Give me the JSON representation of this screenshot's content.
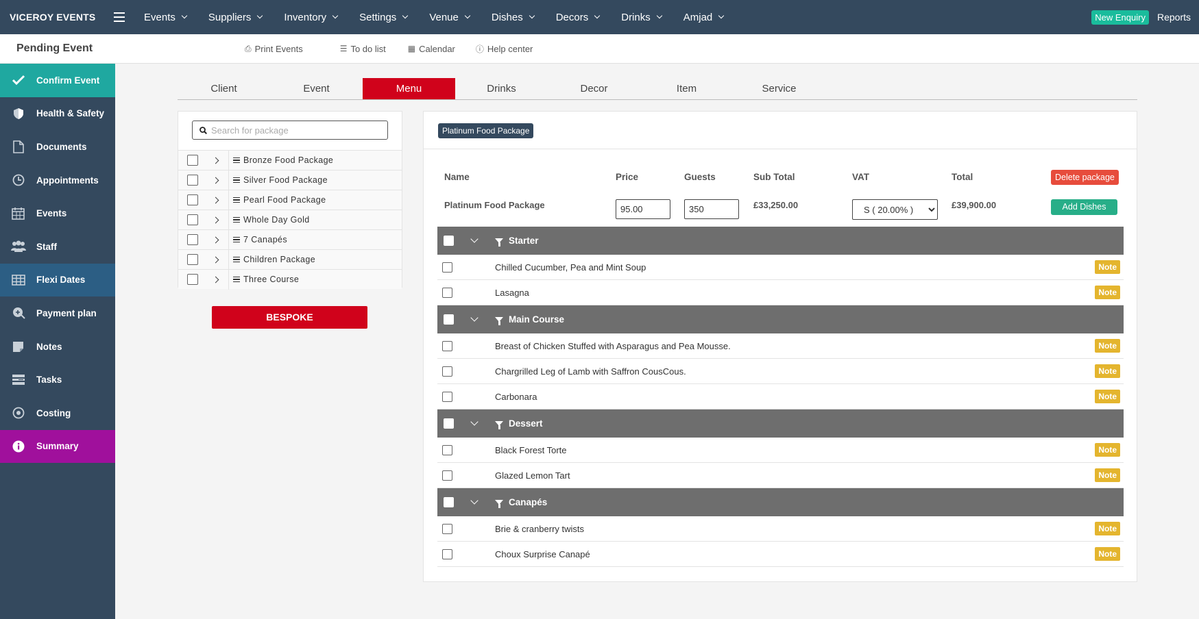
{
  "app": {
    "brand": "VICEROY EVENTS"
  },
  "topnav": {
    "items": [
      "Events",
      "Suppliers",
      "Inventory",
      "Settings",
      "Venue",
      "Dishes",
      "Decors",
      "Drinks",
      "Amjad"
    ],
    "new_enquiry": "New Enquiry",
    "reports": "Reports"
  },
  "subheader": {
    "title": "Pending Event",
    "links": [
      "Print Events",
      "To do list",
      "Calendar",
      "Help center"
    ]
  },
  "sidebar": {
    "items": [
      {
        "label": "Confirm Event",
        "icon": "check-icon",
        "state": "teal"
      },
      {
        "label": "Health & Safety",
        "icon": "shield-icon",
        "state": ""
      },
      {
        "label": "Documents",
        "icon": "document-icon",
        "state": ""
      },
      {
        "label": "Appointments",
        "icon": "clock-icon",
        "state": ""
      },
      {
        "label": "Events",
        "icon": "calendar-icon",
        "state": ""
      },
      {
        "label": "Staff",
        "icon": "users-icon",
        "state": ""
      },
      {
        "label": "Flexi Dates",
        "icon": "table-icon",
        "state": "blue"
      },
      {
        "label": "Payment plan",
        "icon": "payment-icon",
        "state": ""
      },
      {
        "label": "Notes",
        "icon": "sticky-note-icon",
        "state": ""
      },
      {
        "label": "Tasks",
        "icon": "tasks-icon",
        "state": ""
      },
      {
        "label": "Costing",
        "icon": "target-icon",
        "state": ""
      },
      {
        "label": "Summary",
        "icon": "info-icon",
        "state": "purple"
      }
    ]
  },
  "tabs": {
    "items": [
      "Client",
      "Event",
      "Menu",
      "Drinks",
      "Decor",
      "Item",
      "Service"
    ],
    "active": "Menu"
  },
  "packages": {
    "search_placeholder": "Search for package",
    "items": [
      "Bronze Food Package",
      "Silver Food Package",
      "Pearl Food Package",
      "Whole Day Gold",
      "7 Canapés",
      "Children Package",
      "Three Course"
    ],
    "bespoke_label": "BESPOKE"
  },
  "detail": {
    "badge": "Platinum Food Package",
    "headers": {
      "name": "Name",
      "price": "Price",
      "guests": "Guests",
      "subtotal": "Sub Total",
      "vat": "VAT",
      "total": "Total"
    },
    "row": {
      "name": "Platinum Food Package",
      "price": "95.00",
      "guests": "350",
      "subtotal": "£33,250.00",
      "vat": "S ( 20.00% )",
      "total": "£39,900.00"
    },
    "delete_label": "Delete package",
    "add_label": "Add Dishes",
    "note_label": "Note",
    "courses": [
      {
        "name": "Starter",
        "dishes": [
          "Chilled Cucumber, Pea and Mint Soup",
          "Lasagna"
        ]
      },
      {
        "name": "Main Course",
        "dishes": [
          "Breast of Chicken Stuffed with Asparagus and Pea Mousse.",
          "Chargrilled Leg of Lamb with Saffron CousCous.",
          "Carbonara"
        ]
      },
      {
        "name": "Dessert",
        "dishes": [
          "Black Forest Torte",
          "Glazed Lemon Tart"
        ]
      },
      {
        "name": "Canapés",
        "dishes": [
          "Brie & cranberry twists",
          "Choux Surprise Canapé"
        ]
      }
    ]
  },
  "colors": {
    "topbar": "#34495e",
    "teal": "#1fa8a0",
    "blue": "#2c5e84",
    "purple": "#a0109c",
    "red": "#d0021b",
    "note": "#e4b52e"
  }
}
